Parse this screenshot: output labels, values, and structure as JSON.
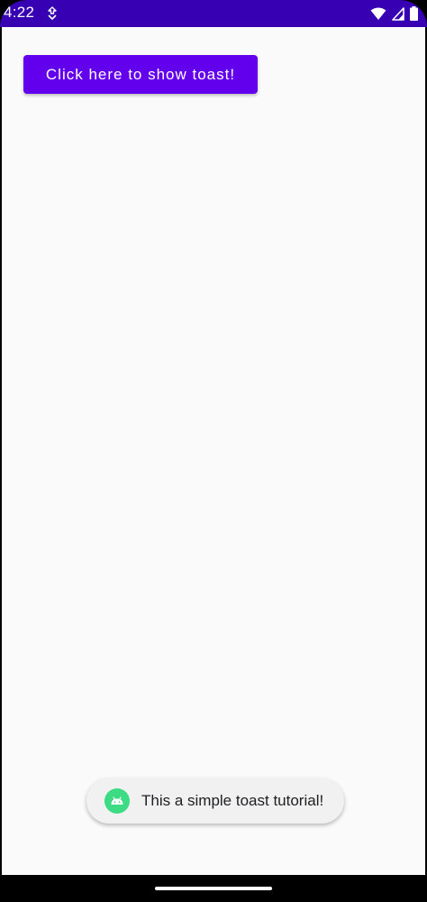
{
  "status_bar": {
    "time": "4:22",
    "icons": [
      "download-notification-icon",
      "wifi-icon",
      "cellular-signal-icon",
      "battery-icon"
    ],
    "background_color": "#3700b3"
  },
  "main": {
    "button_label": "Click here to show toast!",
    "button_color": "#6200ee",
    "background_color": "#fafafa"
  },
  "toast": {
    "icon": "android-icon",
    "message": "This a simple toast tutorial!",
    "icon_color": "#3ddc84"
  },
  "nav_bar": {
    "handle": "gesture-handle"
  }
}
